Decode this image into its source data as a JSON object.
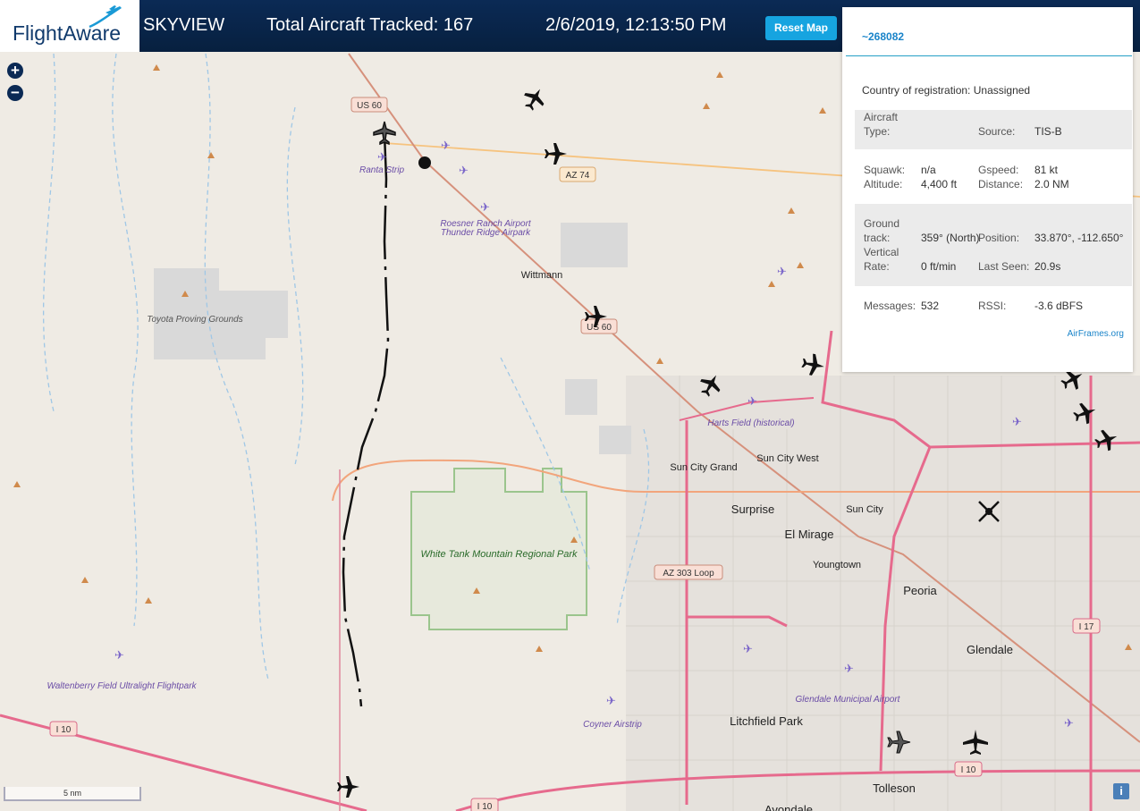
{
  "header": {
    "logo_text": "FlightAware",
    "app_title": "SKYVIEW",
    "aircraft_tracked": "Total Aircraft Tracked: 167",
    "datetime": "2/6/2019, 12:13:50 PM",
    "reset_label": "Reset Map"
  },
  "zoom": {
    "in": "+",
    "out": "−"
  },
  "panel": {
    "aircraft_id": "~268082",
    "country": "Country of registration: Unassigned",
    "aircraft_type_label": "Aircraft Type:",
    "aircraft_type_value": "",
    "source_label": "Source:",
    "source_value": "TIS-B",
    "squawk_label": "Squawk:",
    "squawk_value": "n/a",
    "gspeed_label": "Gspeed:",
    "gspeed_value": "81 kt",
    "altitude_label": "Altitude:",
    "altitude_value": "4,400 ft",
    "distance_label": "Distance:",
    "distance_value": "2.0 NM",
    "track_label": "Ground track:",
    "track_value": "359° (North)",
    "position_label": "Position:",
    "position_value": "33.870°, -112.650°",
    "vrate_label": "Vertical Rate:",
    "vrate_value": "0 ft/min",
    "lastseen_label": "Last Seen:",
    "lastseen_value": "20.9s",
    "messages_label": "Messages:",
    "messages_value": "532",
    "rssi_label": "RSSI:",
    "rssi_value": "-3.6 dBFS",
    "airframes_link": "AirFrames.org"
  },
  "map": {
    "scale_label": "5 nm",
    "info_icon": "i",
    "labels": {
      "ranta": "Ranta Strip",
      "roesner": "Roesner Ranch Airport",
      "thunder": "Thunder Ridge Airpark",
      "wittmann": "Wittmann",
      "toyota": "Toyota Proving Grounds",
      "whitetank": "White Tank Mountain Regional Park",
      "waltenberry": "Waltenberry Field Ultralight Flightpark",
      "harts": "Harts Field (historical)",
      "suncitygrand": "Sun City Grand",
      "suncitywest": "Sun City West",
      "surprise": "Surprise",
      "suncity": "Sun City",
      "elmirage": "El Mirage",
      "youngtown": "Youngtown",
      "peoria": "Peoria",
      "glendale": "Glendale",
      "glendale_airport": "Glendale Municipal Airport",
      "coyner": "Coyner Airstrip",
      "litchfield": "Litchfield Park",
      "tolleson": "Tolleson",
      "avondale": "Avondale"
    },
    "shields": {
      "us60a": "US 60",
      "us60b": "US 60",
      "az74": "AZ 74",
      "az303": "AZ 303 Loop",
      "i10a": "I 10",
      "i10b": "I 10",
      "i10c": "I 10",
      "i17": "I 17"
    }
  }
}
